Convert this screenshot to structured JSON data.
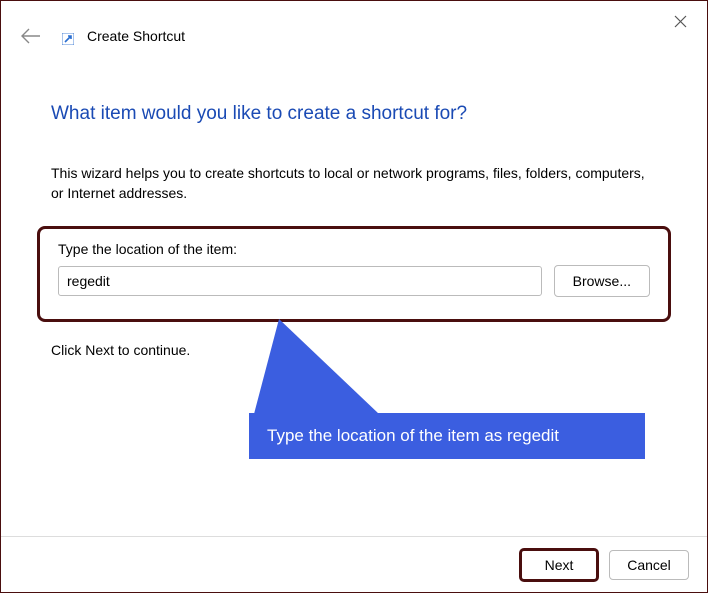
{
  "titlebar": {
    "app_title": "Create Shortcut"
  },
  "content": {
    "heading": "What item would you like to create a shortcut for?",
    "description": "This wizard helps you to create shortcuts to local or network programs, files, folders, computers, or Internet addresses.",
    "field_label": "Type the location of the item:",
    "location_value": "regedit",
    "browse_label": "Browse...",
    "continue_text": "Click Next to continue."
  },
  "callout": {
    "text": "Type the location of the item as regedit"
  },
  "footer": {
    "next_label": "Next",
    "cancel_label": "Cancel"
  }
}
